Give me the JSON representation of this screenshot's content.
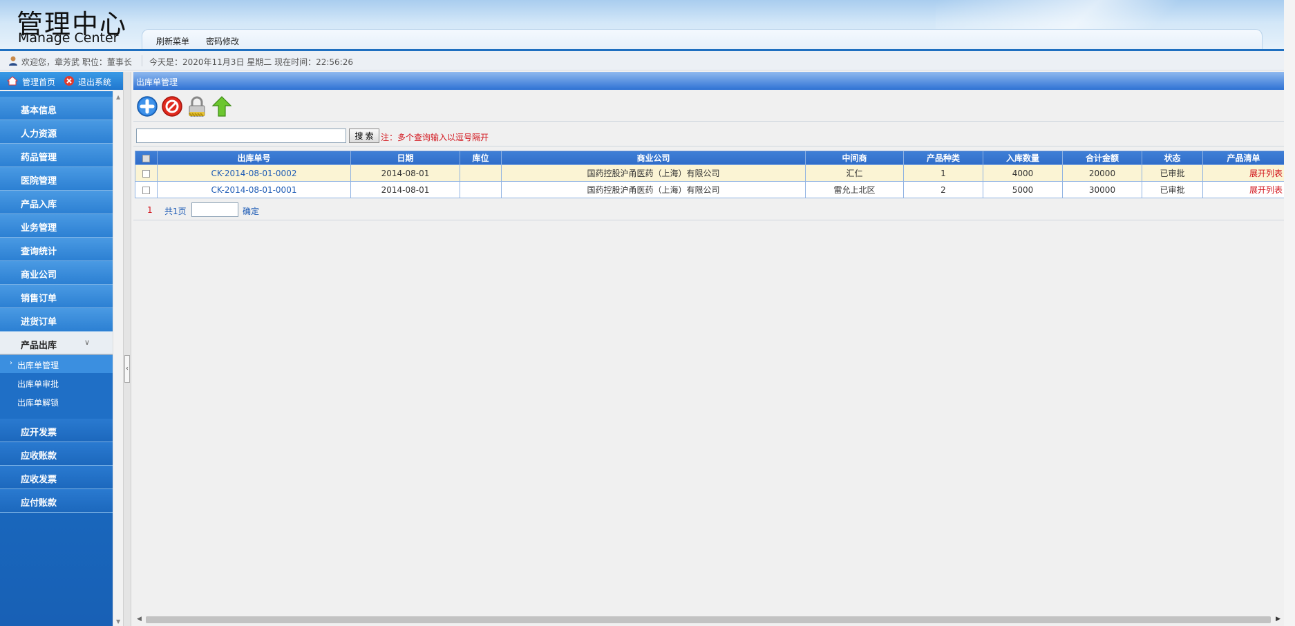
{
  "header": {
    "logo_cn": "管理中心",
    "logo_en": "Manage Center",
    "nav": [
      "刷新菜单",
      "密码修改"
    ]
  },
  "infobar": {
    "welcome": "欢迎您，章芳武  职位：董事长",
    "today": "今天是：2020年11月3日 星期二 现在时间：22:56:26"
  },
  "leftbar_top": {
    "home": "管理首页",
    "logout": "退出系统"
  },
  "sidebar": {
    "items": [
      "基本信息",
      "人力资源",
      "药品管理",
      "医院管理",
      "产品入库",
      "业务管理",
      "查询统计",
      "商业公司",
      "销售订单",
      "进货订单"
    ],
    "active": "产品出库",
    "subitems": [
      "出库单管理",
      "出库单审批",
      "出库单解锁"
    ],
    "bottom_items": [
      "应开发票",
      "应收账款",
      "应收发票",
      "应付账款"
    ]
  },
  "main": {
    "title": "出库单管理",
    "toolbar_icons": [
      "add-icon",
      "delete-icon",
      "lock-icon",
      "upload-icon"
    ],
    "search": {
      "value": "",
      "button": "搜 索",
      "note": "注：多个查询输入以逗号隔开"
    },
    "table": {
      "headers": [
        "出库单号",
        "日期",
        "库位",
        "商业公司",
        "中间商",
        "产品种类",
        "入库数量",
        "合计金额",
        "状态",
        "产品清单"
      ],
      "rows": [
        [
          "CK-2014-08-01-0002",
          "2014-08-01",
          "",
          "国药控股沪甬医药（上海）有限公司",
          "汇仁",
          "1",
          "4000",
          "20000",
          "已审批",
          "展开列表"
        ],
        [
          "CK-2014-08-01-0001",
          "2014-08-01",
          "",
          "国药控股沪甬医药（上海）有限公司",
          "雷允上北区",
          "2",
          "5000",
          "30000",
          "已审批",
          "展开列表"
        ]
      ]
    },
    "pager": {
      "page": "1",
      "total": "共1页",
      "go": "确定"
    }
  },
  "colors": {
    "brand_blue": "#1e6fc0",
    "link": "#1d5bb5",
    "alert_red": "#d2141c",
    "highlight_row": "#fbf4d4"
  }
}
